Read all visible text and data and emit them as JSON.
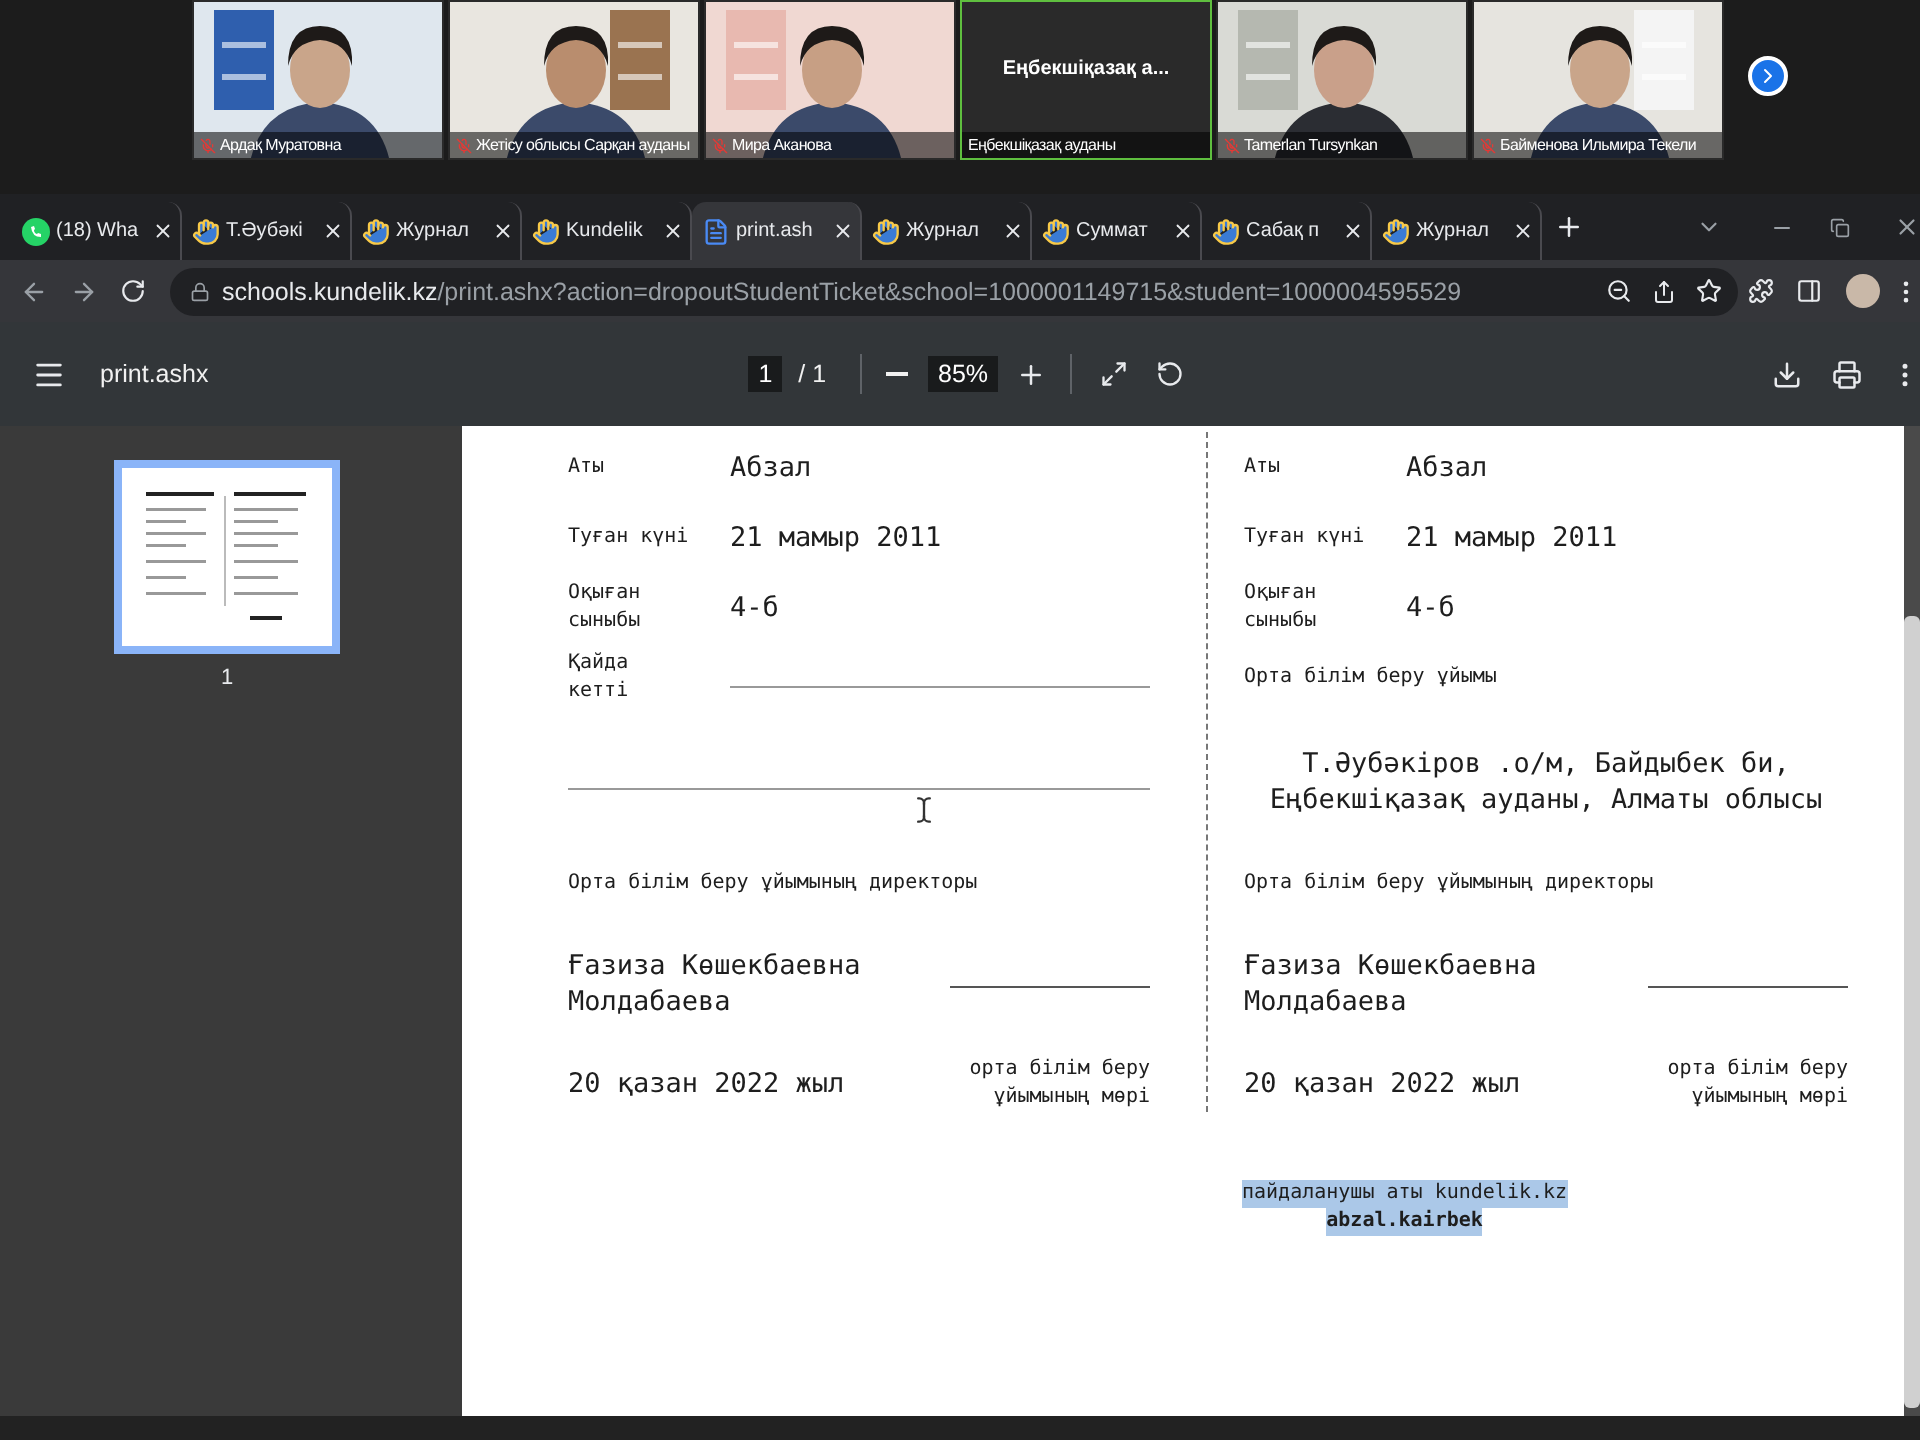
{
  "video_call": {
    "participants": [
      {
        "kind": "video",
        "name": "Ардақ Муратовна",
        "muted": true,
        "speaking": false
      },
      {
        "kind": "video",
        "name": "Жетісу облысы Сарқан ауданы",
        "muted": true,
        "speaking": false
      },
      {
        "kind": "video",
        "name": "Мира Аканова",
        "muted": true,
        "speaking": false
      },
      {
        "kind": "name_card",
        "card_text": "Еңбекшіқазақ а...",
        "name": "Еңбекшіқазақ ауданы",
        "muted": false,
        "speaking": true
      },
      {
        "kind": "video",
        "name": "Tamerlan Tursynkan",
        "muted": true,
        "speaking": false
      },
      {
        "kind": "video",
        "name": "Байменова Ильмира Текели",
        "muted": true,
        "speaking": false
      }
    ]
  },
  "browser": {
    "tabs": [
      {
        "kind": "chat",
        "title": "(18) Wha",
        "selected": false
      },
      {
        "kind": "site",
        "title": "Т.Әубәкі",
        "selected": false
      },
      {
        "kind": "site",
        "title": "Журнал",
        "selected": false
      },
      {
        "kind": "site",
        "title": "Kundelik",
        "selected": false
      },
      {
        "kind": "document",
        "title": "print.ash",
        "selected": true
      },
      {
        "kind": "site",
        "title": "Журнал",
        "selected": false
      },
      {
        "kind": "site",
        "title": "Суммат",
        "selected": false
      },
      {
        "kind": "site",
        "title": "Сабақ п",
        "selected": false
      },
      {
        "kind": "site",
        "title": "Журнал",
        "selected": false
      }
    ],
    "address": {
      "host": "schools.kundelik.kz",
      "path": "/print.ashx?action=dropoutStudentTicket&school=1000001149715&student=1000004595529"
    }
  },
  "pdf_viewer": {
    "title": "print.ashx",
    "page": "1",
    "page_count": "/ 1",
    "zoom": "85%",
    "thumbnails": [
      {
        "label": "1",
        "selected": true
      }
    ],
    "document": {
      "left": {
        "fields": [
          {
            "kind": "value",
            "label": "Аты",
            "value": "Абзал"
          },
          {
            "kind": "value",
            "label": "Туған күні",
            "value": "21 мамыр 2011"
          },
          {
            "kind": "value",
            "label": "Оқыған сыныбы",
            "value": "4-б"
          },
          {
            "kind": "blank",
            "label": "Қайда кетті"
          }
        ],
        "director_label": "Орта білім беру ұйымының директоры",
        "director_name": "Ғазиза Көшекбаевна Молдабаева",
        "date": "20 қазан 2022 жыл",
        "stamp": "орта білім беру ұйымының мөрі"
      },
      "right": {
        "fields": [
          {
            "kind": "value",
            "label": "Аты",
            "value": "Абзал"
          },
          {
            "kind": "value",
            "label": "Туған күні",
            "value": "21 мамыр 2011"
          },
          {
            "kind": "value",
            "label": "Оқыған сыныбы",
            "value": "4-б"
          }
        ],
        "organization_label": "Орта білім беру ұйымы",
        "organization_lines": [
          "Т.Әубәкіров .о/м, Байдыбек би,",
          "Еңбекшіқазақ ауданы, Алматы облысы"
        ],
        "director_label": "Орта білім беру ұйымының директоры",
        "director_name": "Ғазиза Көшекбаевна Молдабаева",
        "date": "20 қазан 2022 жыл",
        "stamp": "орта білім беру ұйымының мөрі"
      },
      "footer": [
        {
          "text": "пайдаланушы аты kundelik.kz",
          "bold": false,
          "highlighted": true
        },
        {
          "text": "abzal.kairbek",
          "bold": true,
          "highlighted": true
        }
      ]
    }
  }
}
